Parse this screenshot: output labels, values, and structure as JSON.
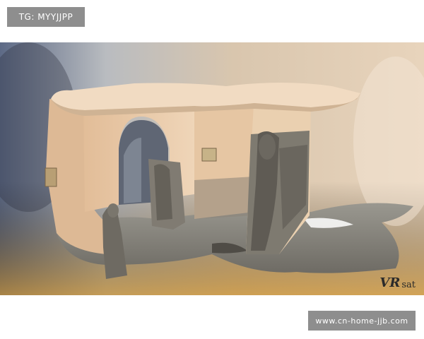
{
  "top_badge": {
    "text": "TG: MYYJJPP"
  },
  "bottom_badge": {
    "text": "www.cn-home-jjb.com"
  },
  "photo": {
    "subject": "3D reconstruction of an ancient gateway with guardian statues",
    "colors": {
      "wall": "#e8c9a6",
      "wall_shadow": "#c9a482",
      "stone": "#8a8880",
      "stone_dark": "#55524c",
      "roof": "#f1dbc2",
      "bg_left": "#6c7690",
      "bg_right": "#e4d0b8",
      "bg_bottom": "#d6a24a"
    }
  },
  "watermark": {
    "mark": "VR",
    "text": "sat"
  }
}
